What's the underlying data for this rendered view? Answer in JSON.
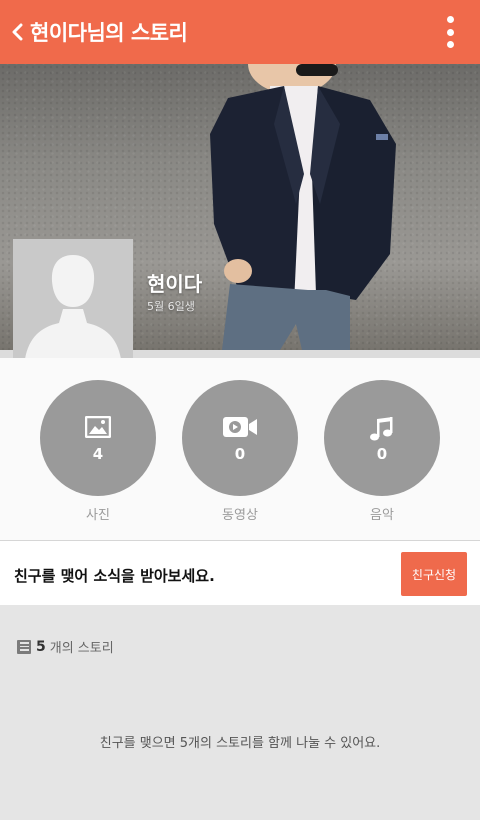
{
  "app_bar": {
    "title": "현이다님의 스토리",
    "back_icon": "chevron-left-icon",
    "menu_icon": "more-vert-icon",
    "color": "#f06a4b"
  },
  "profile": {
    "name": "현이다",
    "birthday": "5월 6일생",
    "avatar_icon": "person-silhouette-icon"
  },
  "media": [
    {
      "key": "photo",
      "icon": "image-icon",
      "count": "4",
      "label": "사진"
    },
    {
      "key": "video",
      "icon": "video-camera-icon",
      "count": "0",
      "label": "동영상"
    },
    {
      "key": "music",
      "icon": "music-note-icon",
      "count": "0",
      "label": "음악"
    }
  ],
  "friend_prompt": {
    "message": "친구를 맺어 소식을 받아보세요.",
    "button_label": "친구신청",
    "button_color": "#ef6a4c"
  },
  "stories": {
    "count": "5",
    "suffix": "개의 스토리",
    "empty_message": "친구를 맺으면 5개의 스토리를 함께 나눌 수 있어요."
  }
}
